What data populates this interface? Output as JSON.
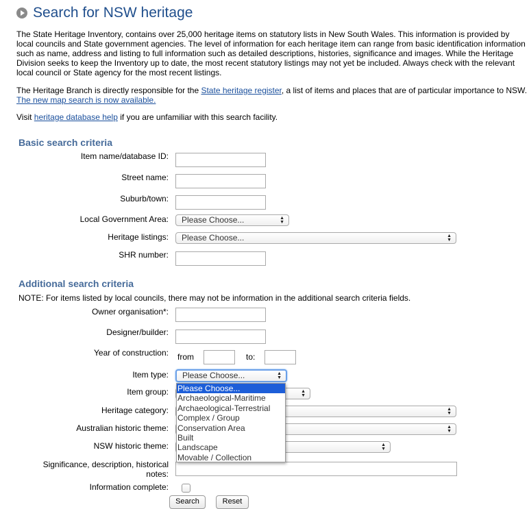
{
  "header": {
    "title": "Search for NSW heritage"
  },
  "intro": {
    "paragraph1": "The State Heritage Inventory, contains over 25,000 heritage items on statutory lists in New South Wales. This information is provided by local councils and State government agencies. The level of information for each heritage item can range from basic identification information such as name, address and listing to full information such as detailed descriptions, histories, significance and images. While the Heritage Division seeks to keep the Inventory up to date, the most recent statutory listings may not yet be included. Always check with the relevant local council or State agency for the most recent listings.",
    "paragraph2_pre": "The Heritage Branch is directly responsible for the ",
    "register_link": "State heritage register",
    "paragraph2_post": ", a list of items and places that are of particular importance to NSW.",
    "map_link": "The new map search is now available.",
    "visit_pre": "Visit ",
    "help_link": "heritage database help",
    "visit_post": " if you are unfamiliar with this search facility."
  },
  "basic": {
    "title": "Basic search criteria",
    "item_name_label": "Item name/database ID:",
    "item_name_value": "",
    "street_label": "Street name:",
    "street_value": "",
    "suburb_label": "Suburb/town:",
    "suburb_value": "",
    "lga_label": "Local Government Area:",
    "lga_selected": "Please Choose...",
    "listings_label": "Heritage listings:",
    "listings_selected": "Please Choose...",
    "shr_label": "SHR number:",
    "shr_value": ""
  },
  "additional": {
    "title": "Additional search criteria",
    "note": "NOTE: For items listed by local councils, there may not be information in the additional search criteria fields.",
    "owner_label": "Owner organisation*:",
    "designer_label": "Designer/builder:",
    "year_label": "Year of construction:",
    "year_from": "from",
    "year_to": "to:",
    "item_type_label": "Item type:",
    "item_type_selected": "Please Choose...",
    "item_group_label": "Item group:",
    "heritage_category_label": "Heritage category:",
    "aus_theme_label": "Australian historic theme:",
    "nsw_theme_label": "NSW historic theme:",
    "significance_label_line1": "Significance, description, historical",
    "significance_label_line2": "notes:",
    "info_complete_label": "Information complete:"
  },
  "item_type_options": [
    "Please Choose...",
    "Archaeological-Maritime",
    "Archaeological-Terrestrial",
    "Complex / Group",
    "Conservation Area",
    "Built",
    "Landscape",
    "Movable / Collection"
  ],
  "buttons": {
    "search": "Search",
    "reset": "Reset"
  },
  "colors": {
    "title": "#1f4e8c",
    "section_title": "#466b9a",
    "link": "#1a4f9c",
    "dropdown_highlight": "#1d5ed8"
  }
}
